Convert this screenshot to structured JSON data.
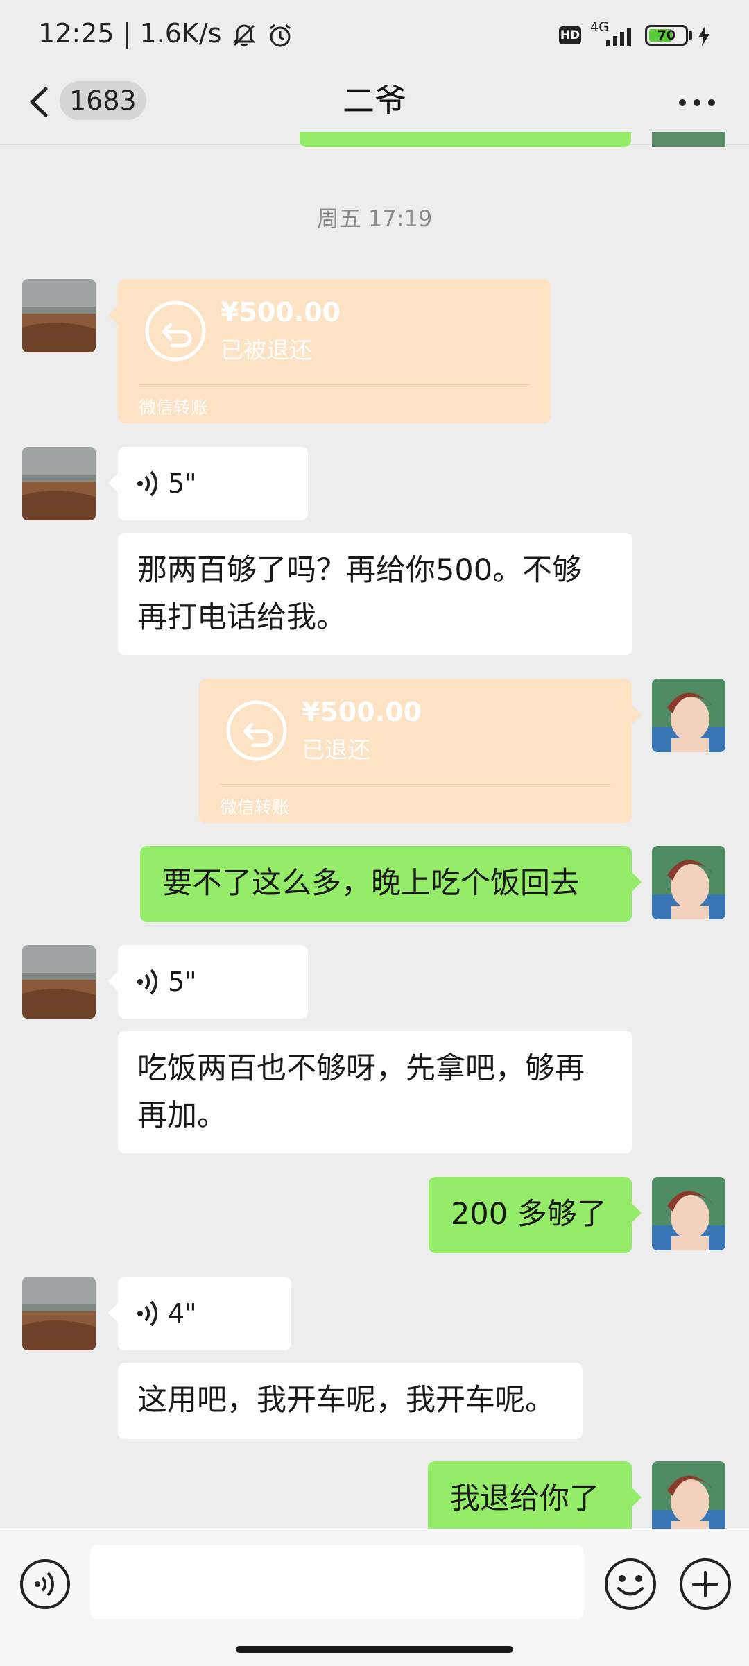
{
  "status_bar": {
    "time": "12:25",
    "speed": "1.6K/s",
    "hd": "HD",
    "network": "4G",
    "battery": "70",
    "battery_level": 0.7
  },
  "header": {
    "unread_count": "1683",
    "title": "二爷"
  },
  "messages": {
    "time_separator": "周五 17:19",
    "transfer_received": {
      "amount": "¥500.00",
      "status": "已被退还",
      "footer": "微信转账"
    },
    "voice_1": {
      "duration": "5\""
    },
    "text_1": {
      "line1": "那两百够了吗？再给你500。不够",
      "line2": "再打电话给我。"
    },
    "transfer_sent": {
      "amount": "¥500.00",
      "status": "已退还",
      "footer": "微信转账"
    },
    "text_2": "要不了这么多，晚上吃个饭回去",
    "voice_2": {
      "duration": "5\""
    },
    "text_3": {
      "line1": "吃饭两百也不够呀，先拿吧，够再",
      "line2": "再加。"
    },
    "text_4": "200 多够了",
    "voice_3": {
      "duration": "4\""
    },
    "text_5": "这用吧，我开车呢，我开车呢。",
    "text_6": "我退给你了"
  },
  "input": {
    "placeholder": "",
    "value": ""
  },
  "icons": {
    "back": "chevron-left-icon",
    "more": "more-dots-icon",
    "voice": "voice-wave-icon",
    "emoji": "emoji-icon",
    "plus": "plus-icon",
    "refund": "refund-arrow-icon"
  },
  "colors": {
    "background": "#ededed",
    "sent_bubble": "#95ec69",
    "received_bubble": "#ffffff",
    "transfer_refunded": "#fde2c3"
  }
}
